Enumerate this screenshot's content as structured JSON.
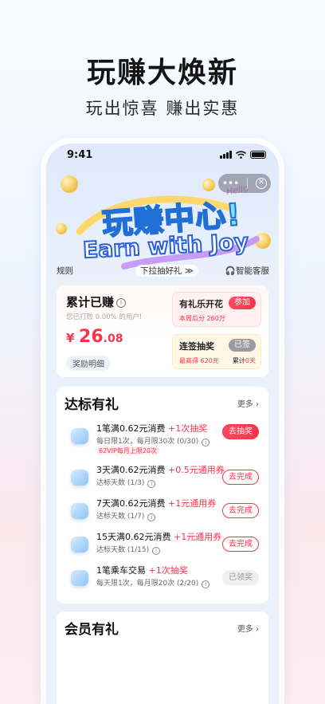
{
  "promo": {
    "headline": "玩赚大焕新",
    "subline": "玩出惊喜  赚出实惠"
  },
  "status_bar": {
    "time": "9:41"
  },
  "hero": {
    "title_zh": "玩赚中心!",
    "title_en": "Earn with Joy",
    "hello": "Hello",
    "links": {
      "rules": "规则",
      "pulldown": "下拉抽好礼 ≫",
      "service": "智能客服"
    }
  },
  "earn": {
    "title": "累计已赚",
    "beat_text": "您已打败 0.00% 的用户!",
    "currency": "¥",
    "amount_int": "26",
    "amount_dec": ".08",
    "detail_button": "奖励明细",
    "flower": {
      "title": "有礼乐开花",
      "button": "参加",
      "sub": "本周瓜分 260万"
    },
    "signin": {
      "title": "连签抽奖",
      "button": "已签",
      "sub": "最高得 620元",
      "sub2": "累计",
      "days": "0天"
    }
  },
  "tasks": {
    "title": "达标有礼",
    "more": "更多 ›",
    "items": [
      {
        "title": "1笔满0.62元消费",
        "reward": "+1次抽奖",
        "desc": "每日限1次，每月限30次 (0/30)",
        "tag": "62VIP每月上限20次",
        "button": "去抽奖"
      },
      {
        "title": "3天满0.62元消费",
        "reward": "+0.5元通用券",
        "desc": "达标天数 (1/3)",
        "button": "去完成"
      },
      {
        "title": "7天满0.62元消费",
        "reward": "+1元通用券",
        "desc": "达标天数 (1/7)",
        "button": "去完成"
      },
      {
        "title": "15天满0.62元消费",
        "reward": "+1元通用券",
        "desc": "达标天数 (1/15)",
        "button": "去完成"
      },
      {
        "title": "1笔乘车交易",
        "reward": "+1次抽奖",
        "desc": "每天限1次，每月限20次 (2/20)",
        "button": "已领奖"
      }
    ]
  },
  "member": {
    "title": "会员有礼",
    "more": "更多 ›"
  },
  "colors": {
    "accent": "#f2354a",
    "card": "#ffffff",
    "phone_bg": "#eaf1fb"
  }
}
